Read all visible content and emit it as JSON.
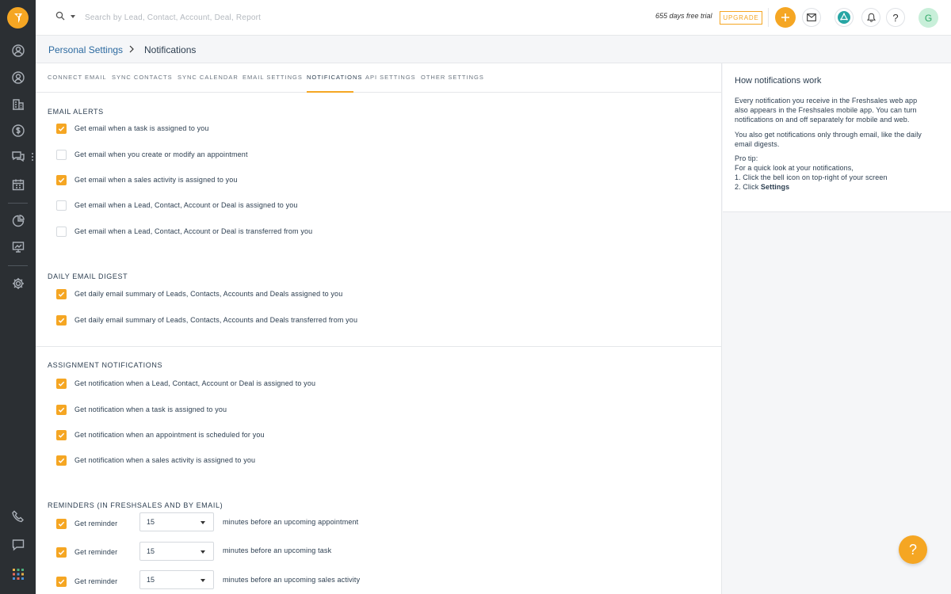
{
  "topbar": {
    "search_placeholder": "Search by Lead, Contact, Account, Deal, Report",
    "trial_text": "655 days free trial",
    "upgrade_label": "UPGRADE",
    "avatar_initial": "G"
  },
  "breadcrumb": {
    "parent": "Personal Settings",
    "current": "Notifications"
  },
  "tabs": [
    {
      "label": "CONNECT EMAIL"
    },
    {
      "label": "SYNC CONTACTS"
    },
    {
      "label": "SYNC CALENDAR"
    },
    {
      "label": "EMAIL SETTINGS"
    },
    {
      "label": "NOTIFICATIONS",
      "active": true
    },
    {
      "label": "API SETTINGS"
    },
    {
      "label": "OTHER SETTINGS"
    }
  ],
  "email_alerts": {
    "title": "EMAIL ALERTS",
    "items": [
      {
        "label": "Get email when a task is assigned to you",
        "checked": true
      },
      {
        "label": "Get email when you create or modify an appointment",
        "checked": false
      },
      {
        "label": "Get email when a sales activity is assigned to you",
        "checked": true
      },
      {
        "label": "Get email when a Lead, Contact, Account or Deal is assigned to you",
        "checked": false
      },
      {
        "label": "Get email when a Lead, Contact, Account or Deal is transferred from you",
        "checked": false
      }
    ]
  },
  "daily_digest": {
    "title": "DAILY EMAIL DIGEST",
    "items": [
      {
        "label": "Get daily email summary of Leads, Contacts, Accounts and Deals assigned to you",
        "checked": true
      },
      {
        "label": "Get daily email summary of Leads, Contacts, Accounts and Deals transferred from you",
        "checked": true
      }
    ]
  },
  "assignment": {
    "title": "ASSIGNMENT NOTIFICATIONS",
    "items": [
      {
        "label": "Get notification when a Lead, Contact, Account or Deal is assigned to you",
        "checked": true
      },
      {
        "label": "Get notification when a task is assigned to you",
        "checked": true
      },
      {
        "label": "Get notification when an appointment is scheduled for you",
        "checked": true
      },
      {
        "label": "Get notification when a sales activity is assigned to you",
        "checked": true
      }
    ]
  },
  "reminders": {
    "title": "REMINDERS (IN FRESHSALES AND BY EMAIL)",
    "items": [
      {
        "label": "Get reminder",
        "checked": true,
        "value": "15",
        "suffix": "minutes before an upcoming appointment"
      },
      {
        "label": "Get reminder",
        "checked": true,
        "value": "15",
        "suffix": "minutes before an upcoming task"
      },
      {
        "label": "Get reminder",
        "checked": true,
        "value": "15",
        "suffix": "minutes before an upcoming sales activity"
      }
    ]
  },
  "side_panel": {
    "title": "How notifications work",
    "para1": [
      "Every notification you receive in the Freshsales web app",
      "also appears in the Freshsales mobile app. You can turn",
      "notifications on and off separately for mobile and web."
    ],
    "para2": [
      "You also get notifications only through email, like the daily",
      "email digests."
    ],
    "tip_heading": "Pro tip:",
    "tip_line1": "For a quick look at your notifications,",
    "tip_line2": "1. Click the bell icon on top-right of your screen",
    "tip_line3_prefix": "2. Click ",
    "tip_line3_bold": "Settings"
  },
  "help_fab_label": "?",
  "colors": {
    "accent": "#f5a623",
    "rail": "#2b2f33",
    "link": "#2c6aa0"
  }
}
